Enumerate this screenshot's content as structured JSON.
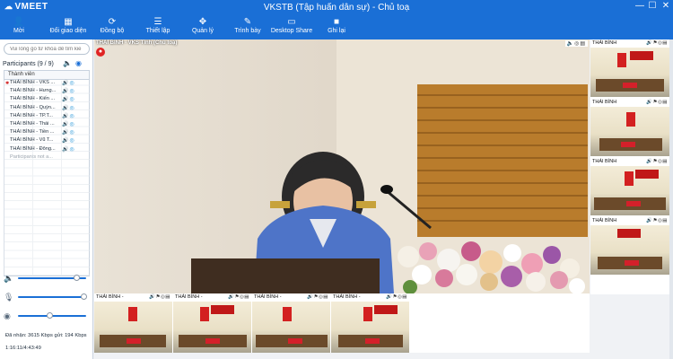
{
  "app": {
    "logo": "VMEET",
    "window_title": "VKSTB (Tập huấn dân sự) - Chủ toạ"
  },
  "toolbar": [
    {
      "label": "Mời",
      "icon": "invite-user-icon"
    },
    {
      "label": "Đổi giao diện",
      "icon": "layout-icon"
    },
    {
      "label": "Đồng bộ",
      "icon": "sync-icon"
    },
    {
      "label": "Thiết lập",
      "icon": "settings-sliders-icon"
    },
    {
      "label": "Quản lý",
      "icon": "manage-icon"
    },
    {
      "label": "Trình bày",
      "icon": "present-icon"
    },
    {
      "label": "Desktop Share",
      "icon": "desktop-share-icon"
    },
    {
      "label": "Ghi lại",
      "icon": "record-icon"
    }
  ],
  "sidebar": {
    "search_placeholder": "Vui lòng gõ từ khóa để tìm kiế",
    "participants_title": "Participants (9 / 9)",
    "column_header": "Thành viên",
    "participants": [
      "THÁI BÌNH - VKS ...",
      "THÁI BÌNH - Hưng...",
      "THÁI BÌNH - Kiến ...",
      "THÁI BÌNH - Quỳn...",
      "THÁI BÌNH - TP.T...",
      "THÁI BÌNH - Thái ...",
      "THÁI BÌNH - Tiền ...",
      "THÁI BÌNH - Vũ T...",
      "THÁI BÌNH - Đông..."
    ],
    "not_attending": "Participants not a...",
    "stats": {
      "bandwidth": "Đã nhận: 3615 Kbps gửi: 194 Kbps",
      "duration": "1:16:11/4:43:49"
    }
  },
  "main_video": {
    "label": "THÁI BÌNH - VKS Tỉnh (Chủ toạ)"
  },
  "right_thumbs": [
    {
      "label": "THÁI BÌNH"
    },
    {
      "label": "THÁI BÌNH"
    },
    {
      "label": "THÁI BÌNH"
    },
    {
      "label": "THÁI BÌNH"
    }
  ],
  "bottom_thumbs": [
    {
      "label": "THÁI BÌNH -"
    },
    {
      "label": "THÁI BÌNH -"
    },
    {
      "label": "THÁI BÌNH -"
    },
    {
      "label": "THÁI BÌNH -"
    }
  ],
  "colors": {
    "brand_blue": "#1a6fd6",
    "record_red": "#e02424"
  }
}
